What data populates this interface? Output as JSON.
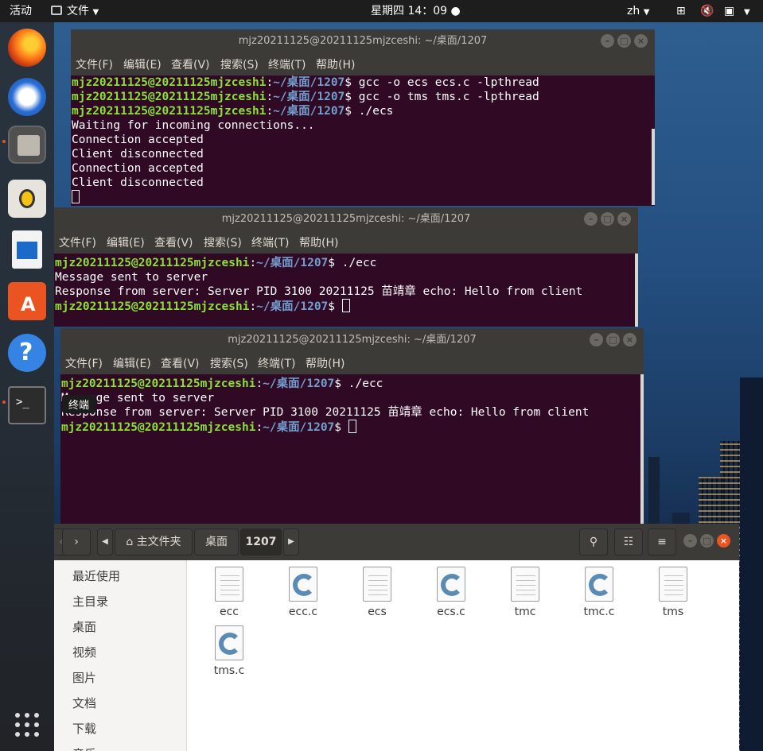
{
  "topbar": {
    "activities": "活动",
    "app_menu": "文件",
    "clock": "星期四 14：09",
    "lang": "zh"
  },
  "dock": {
    "tooltip": "终端",
    "icons": [
      "firefox-icon",
      "thunderbird-icon",
      "files-icon",
      "rhythmbox-icon",
      "writer-icon",
      "software-icon",
      "help-icon",
      "terminal-icon",
      "app-grid-icon"
    ]
  },
  "terminal_menu": [
    "文件(F)",
    "编辑(E)",
    "查看(V)",
    "搜索(S)",
    "终端(T)",
    "帮助(H)"
  ],
  "terminals": [
    {
      "title": "mjz20211125@20211125mjzceshi: ~/桌面/1207",
      "lines": [
        {
          "user": "mjz20211125@20211125mjzceshi",
          "path": "~/桌面/1207",
          "cmd": "gcc -o ecs ecs.c -lpthread"
        },
        {
          "user": "mjz20211125@20211125mjzceshi",
          "path": "~/桌面/1207",
          "cmd": "gcc -o tms tms.c -lpthread"
        },
        {
          "user": "mjz20211125@20211125mjzceshi",
          "path": "~/桌面/1207",
          "cmd": "./ecs"
        },
        {
          "text": "Waiting for incoming connections..."
        },
        {
          "text": "Connection accepted"
        },
        {
          "text": "Client disconnected"
        },
        {
          "text": "Connection accepted"
        },
        {
          "text": "Client disconnected"
        }
      ]
    },
    {
      "title": "mjz20211125@20211125mjzceshi: ~/桌面/1207",
      "lines": [
        {
          "user": "mjz20211125@20211125mjzceshi",
          "path": "~/桌面/1207",
          "cmd": "./ecc"
        },
        {
          "text": "Message sent to server"
        },
        {
          "text": "Response from server: Server PID 3100 20211125 苗靖章 echo: Hello from client"
        },
        {
          "user": "mjz20211125@20211125mjzceshi",
          "path": "~/桌面/1207",
          "cmd": ""
        }
      ]
    },
    {
      "title": "mjz20211125@20211125mjzceshi: ~/桌面/1207",
      "lines": [
        {
          "user": "mjz20211125@20211125mjzceshi",
          "path": "~/桌面/1207",
          "cmd": "./ecc"
        },
        {
          "text": "Message sent to server"
        },
        {
          "text": "Response from server: Server PID 3100 20211125 苗靖章 echo: Hello from client"
        },
        {
          "user": "mjz20211125@20211125mjzceshi",
          "path": "~/桌面/1207",
          "cmd": ""
        }
      ]
    }
  ],
  "files": {
    "breadcrumb": [
      "主文件夹",
      "桌面",
      "1207"
    ],
    "sidebar": [
      "最近使用",
      "主目录",
      "桌面",
      "视频",
      "图片",
      "文档",
      "下载",
      "音乐"
    ],
    "items": [
      {
        "name": "ecc",
        "type": "binary"
      },
      {
        "name": "ecc.c",
        "type": "c"
      },
      {
        "name": "ecs",
        "type": "binary"
      },
      {
        "name": "ecs.c",
        "type": "c"
      },
      {
        "name": "tmc",
        "type": "binary"
      },
      {
        "name": "tmc.c",
        "type": "c"
      },
      {
        "name": "tms",
        "type": "binary"
      },
      {
        "name": "tms.c",
        "type": "c"
      }
    ]
  },
  "colors": {
    "terminal_bg": "#300a24",
    "prompt_user": "#8ae234",
    "prompt_path": "#729fcf",
    "close_button": "#e95420"
  }
}
